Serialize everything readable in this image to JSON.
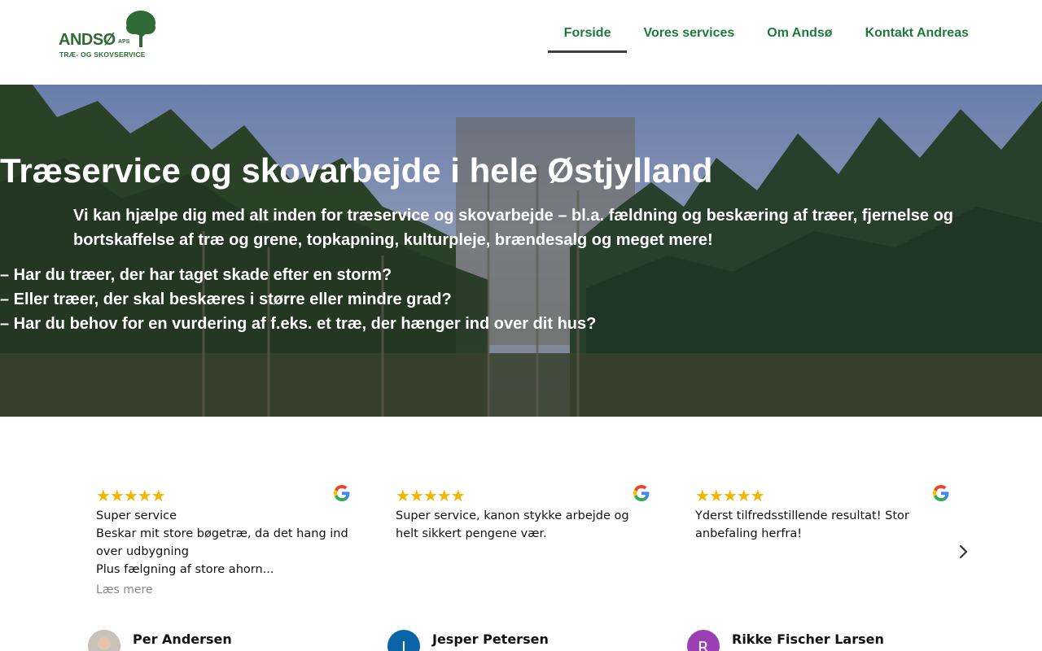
{
  "header": {
    "logo": {
      "wordmark": "ANDSØ",
      "suffix": "APS",
      "tagline": "TRÆ- OG SKOVSERVICE"
    },
    "nav": [
      {
        "label": "Forside",
        "active": true
      },
      {
        "label": "Vores services",
        "active": false
      },
      {
        "label": "Om Andsø",
        "active": false
      },
      {
        "label": "Kontakt Andreas",
        "active": false
      }
    ]
  },
  "hero": {
    "title": "Træservice og skovarbejde i hele Østjylland",
    "intro": "Vi kan hjælpe dig med alt inden for træservice og skovarbejde – bl.a. fældning og beskæring af træer, fjernelse og bortskaffelse af træ og grene, topkapning, kulturpleje, brændesalg og meget mere!",
    "questions": [
      "– Har du træer, der har taget skade efter en storm?",
      "– Eller træer, der skal beskæres i større eller mindre grad?",
      "– Har du behov for en vurdering af f.eks. et træ, der hænger ind over dit hus?"
    ]
  },
  "reviews": {
    "items": [
      {
        "stars": "★★★★★",
        "rating": 5,
        "text": "Super service\nBeskar mit store bøgetræ, da det hang ind over udbygning\nPlus fælgning af store ahorn...",
        "read_more": "Læs mere",
        "name": "Per Andersen",
        "avatar_initial": "",
        "avatar_color": "#b9b4ad"
      },
      {
        "stars": "★★★★★",
        "rating": 5,
        "text": "Super service, kanon stykke arbejde og helt sikkert pengene vær.",
        "read_more": "",
        "name": "Jesper Petersen",
        "avatar_initial": "J",
        "avatar_color": "#0b63a8"
      },
      {
        "stars": "★★★★★",
        "rating": 5,
        "text": "Yderst tilfredsstillende resultat! Stor anbefaling herfra!",
        "read_more": "",
        "name": "Rikke Fischer Larsen",
        "avatar_initial": "R",
        "avatar_color": "#9c3fb5"
      }
    ]
  },
  "colors": {
    "brand_green": "#1e7a3c",
    "star_gold": "#f4b400",
    "nav_underline": "#3b3f44"
  }
}
